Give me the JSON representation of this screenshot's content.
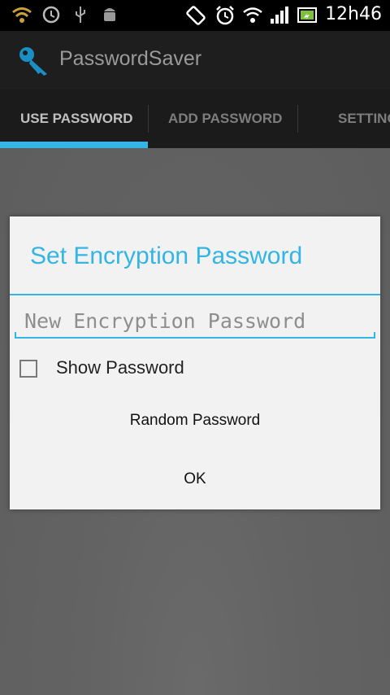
{
  "status_bar": {
    "time": "12h46",
    "icons": [
      "wifi-icon",
      "sync-icon",
      "usb-icon",
      "android-debug-icon",
      "screen-rotation-icon",
      "alarm-icon",
      "wifi-signal-icon",
      "cell-signal-icon",
      "battery-icon"
    ]
  },
  "action_bar": {
    "title": "PasswordSaver",
    "icon": "key-icon"
  },
  "tabs": [
    {
      "label": "USE PASSWORD",
      "active": true
    },
    {
      "label": "ADD PASSWORD",
      "active": false
    },
    {
      "label": "SETTINGS",
      "active": false
    }
  ],
  "dialog": {
    "title": "Set Encryption Password",
    "password_placeholder": "New Encryption Password",
    "password_value": "",
    "show_password_label": "Show Password",
    "show_password_checked": false,
    "random_button": "Random Password",
    "ok_button": "OK"
  },
  "colors": {
    "accent": "#33b5e5",
    "action_bar_bg": "#1e1e1e",
    "dialog_bg": "#f2f2f2"
  }
}
